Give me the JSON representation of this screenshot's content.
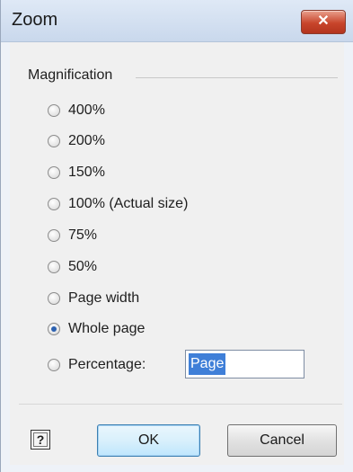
{
  "window": {
    "title": "Zoom",
    "close_glyph": "✕"
  },
  "group": {
    "label": "Magnification"
  },
  "options": [
    {
      "label": "400%",
      "checked": false
    },
    {
      "label": "200%",
      "checked": false
    },
    {
      "label": "150%",
      "checked": false
    },
    {
      "label": "100% (Actual size)",
      "checked": false
    },
    {
      "label": "75%",
      "checked": false
    },
    {
      "label": "50%",
      "checked": false
    },
    {
      "label": "Page width",
      "checked": false
    },
    {
      "label": "Whole page",
      "checked": true
    },
    {
      "label": "Percentage:",
      "checked": false
    }
  ],
  "percentage_field": {
    "value": "Page"
  },
  "buttons": {
    "help": "?",
    "ok": "OK",
    "cancel": "Cancel"
  },
  "colors": {
    "accent": "#2c61b0",
    "close": "#c8452b"
  },
  "icons": {
    "close": "close-icon",
    "help": "help-icon"
  }
}
